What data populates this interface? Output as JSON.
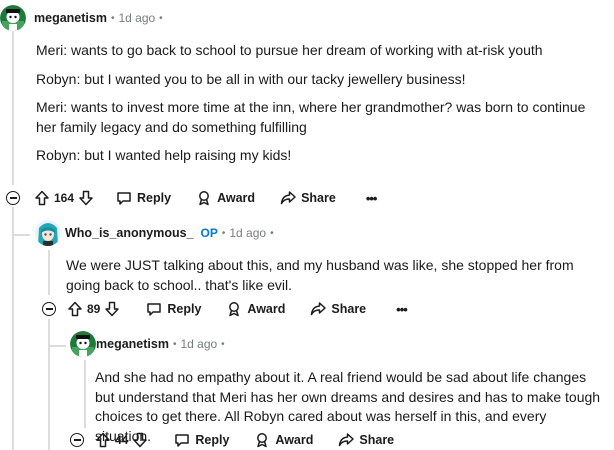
{
  "colors": {
    "op": "#0079d3",
    "meta": "#787c7e",
    "thread_line": "#dcdcdc"
  },
  "comments": [
    {
      "user": "meganetism",
      "time": "1d ago",
      "body": [
        "Meri: wants to go back to school to pursue her dream of working with at-risk youth",
        "Robyn: but I wanted you to be all in with our tacky jewellery business!",
        "Meri: wants to invest more time at the inn, where her grandmother? was born to continue her family legacy and do something fulfilling",
        "Robyn: but I wanted help raising my kids!"
      ],
      "votes": "164",
      "reply": "Reply",
      "award": "Award",
      "share": "Share",
      "more": "•••"
    },
    {
      "user": "Who_is_anonymous_",
      "op_badge": "OP",
      "time": "1d ago",
      "body": [
        "We were JUST talking about this, and my husband was like, she stopped her from going back to school.. that's like evil."
      ],
      "votes": "89",
      "reply": "Reply",
      "award": "Award",
      "share": "Share",
      "more": "•••"
    },
    {
      "user": "meganetism",
      "time": "1d ago",
      "body": [
        "And she had no empathy about it. A real friend would be sad about life changes but understand that Meri has her own dreams and desires and has to make tough choices to get there. All Robyn cared about was herself in this, and every situation."
      ],
      "votes": "44",
      "reply": "Reply",
      "award": "Award",
      "share": "Share"
    }
  ]
}
